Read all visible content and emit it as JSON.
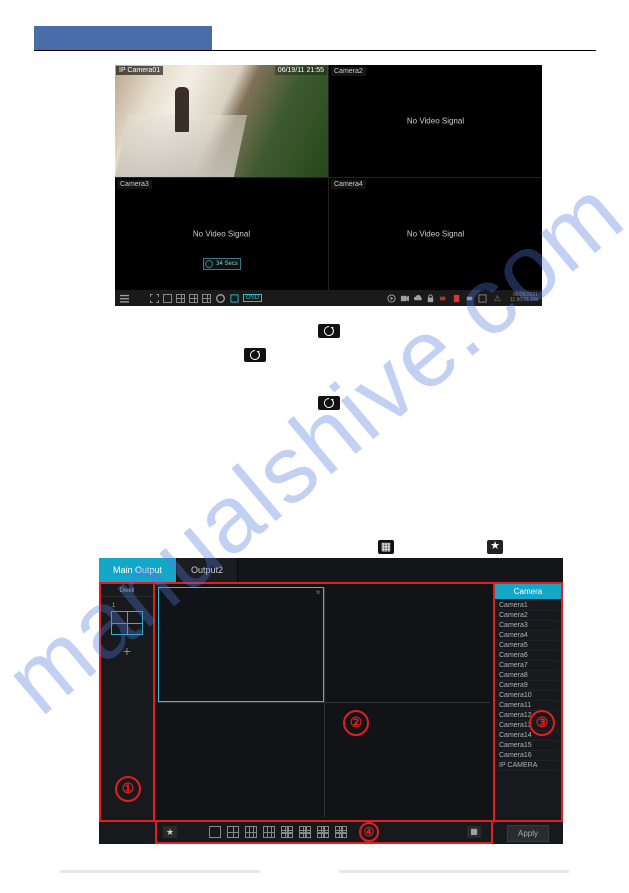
{
  "watermark": "manualshive.com",
  "screenshot1": {
    "cam1": {
      "overlay": "IP Camera01",
      "timestamp": "06/19/11 21:55"
    },
    "cam2": {
      "label": "Camera2",
      "status": "No Video Signal"
    },
    "cam3": {
      "label": "Camera3",
      "status": "No Video Signal"
    },
    "cam4": {
      "label": "Camera4",
      "status": "No Video Signal"
    },
    "osd_button": "34 Secs",
    "toolbar": {
      "osd_label": "OSD",
      "date": "06/06/2021",
      "time": "11:50:01 PM"
    }
  },
  "screenshot2": {
    "tabs": {
      "main": "Main Output",
      "out2": "Output2"
    },
    "left": {
      "dwell": "Dwell",
      "scheme_num": "1",
      "plus": "+"
    },
    "right_header": "Camera",
    "cameras": [
      "Camera1",
      "Camera2",
      "Camera3",
      "Camera4",
      "Camera5",
      "Camera6",
      "Camera7",
      "Camera8",
      "Camera9",
      "Camera10",
      "Camera11",
      "Camera12",
      "Camera13",
      "Camera14",
      "Camera15",
      "Camera16",
      "IP CAMERA"
    ],
    "apply": "Apply",
    "annotations": {
      "a1": "①",
      "a2": "②",
      "a3": "③",
      "a4": "④"
    }
  },
  "inline_icons": {
    "star": "★",
    "calendar": "▦",
    "close": "×",
    "warn": "⚠"
  }
}
